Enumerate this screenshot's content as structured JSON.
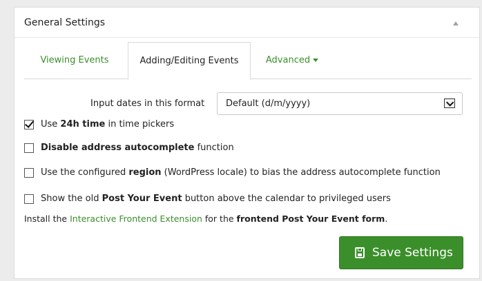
{
  "panel": {
    "title": "General Settings",
    "collapse_icon": "triangle-up-icon"
  },
  "tabs": [
    {
      "label": "Viewing Events",
      "active": false
    },
    {
      "label": "Adding/Editing Events",
      "active": true
    },
    {
      "label": "Advanced",
      "active": false,
      "has_dropdown": true
    }
  ],
  "date_format": {
    "label": "Input dates in this format",
    "selected": "Default (d/m/yyyy)"
  },
  "options": [
    {
      "checked": true,
      "pre": "Use ",
      "bold": "24h time",
      "post": " in time pickers"
    },
    {
      "checked": false,
      "pre": "",
      "bold": "Disable address autocomplete",
      "post": " function"
    },
    {
      "checked": false,
      "pre": "Use the configured ",
      "bold": "region",
      "post": " (WordPress locale) to bias the address autocomplete function"
    },
    {
      "checked": false,
      "pre": "Show the old ",
      "bold": "Post Your Event",
      "post": " button above the calendar to privileged users"
    }
  ],
  "install_note": {
    "pre": "Install the ",
    "link": "Interactive Frontend Extension",
    "mid": " for the ",
    "bold": "frontend Post Your Event form",
    "post": "."
  },
  "save_button": {
    "label": "Save Settings",
    "icon": "floppy-disk-icon"
  },
  "colors": {
    "accent_green": "#3a8e2b",
    "button_green": "#3b8f2b"
  }
}
